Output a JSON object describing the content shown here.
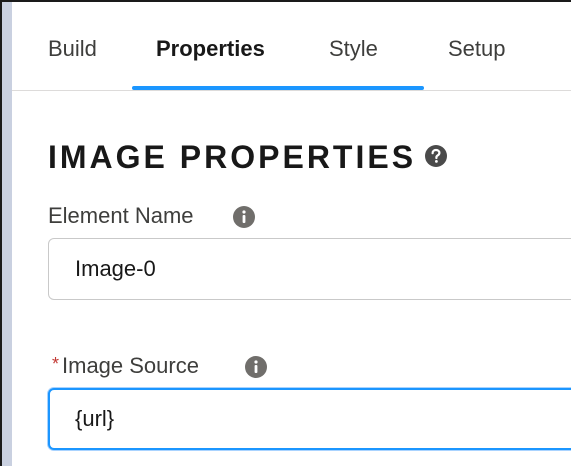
{
  "tabs": [
    {
      "label": "Build",
      "active": false
    },
    {
      "label": "Properties",
      "active": true
    },
    {
      "label": "Style",
      "active": false
    },
    {
      "label": "Setup",
      "active": false
    }
  ],
  "section": {
    "title": "IMAGE PROPERTIES",
    "help_icon": "question-circle-icon"
  },
  "fields": {
    "element_name": {
      "label": "Element Name",
      "info_icon": "info-icon",
      "value": "Image-0"
    },
    "image_source": {
      "label": "Image Source",
      "required_marker": "*",
      "info_icon": "info-icon",
      "value": "{url}"
    }
  },
  "colors": {
    "accent": "#1b96ff",
    "required": "#c23934",
    "icon": "#706e6b",
    "rail": "#c9d0e0"
  }
}
